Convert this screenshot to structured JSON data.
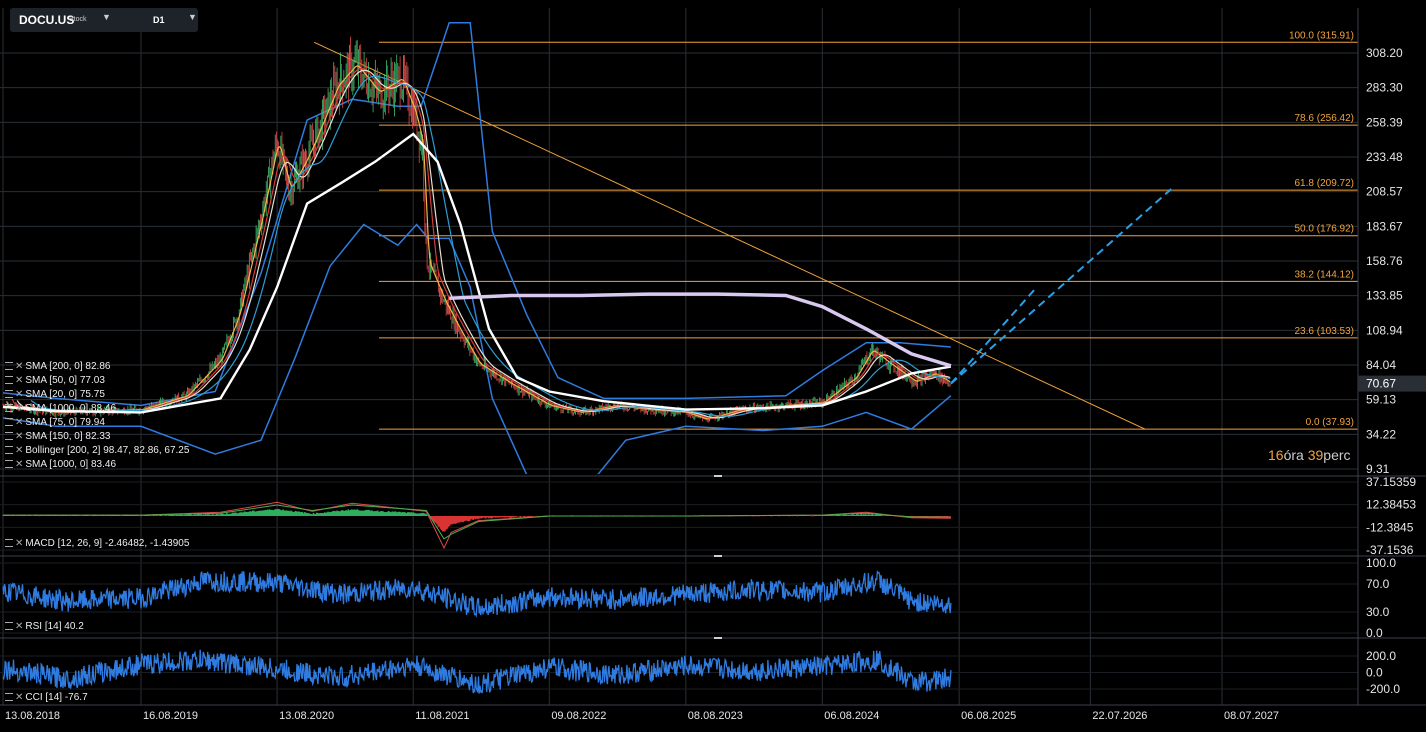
{
  "header": {
    "symbol": "DOCU.US",
    "instrument_type": "Stock",
    "timeframe": "D1",
    "dropdown_glyph": "▼"
  },
  "countdown": {
    "hours": "16",
    "hours_unit": "óra",
    "minutes": "39",
    "minutes_unit": "perc"
  },
  "colors": {
    "background": "#000000",
    "grid": "#2a2f36",
    "fib": "#f2a33c",
    "bollinger": "#2f7be0",
    "sma200": "#ffffff",
    "sma1000": "#d9c8f0",
    "oscillator": "#2f7be0",
    "price_tag": "#2a2f36",
    "projection": "#29a0e8"
  },
  "legends": {
    "main": [
      "SMA [200, 0] 82.86",
      "SMA [50, 0] 77.03",
      "SMA [20, 0] 75.75",
      "SMA [1000, 0] 83.46",
      "SMA [75, 0] 79.94",
      "SMA [150, 0] 82.33",
      "Bollinger [200, 2] 98.47, 82.86, 67.25",
      "SMA [1000, 0] 83.46"
    ],
    "macd": "MACD [12, 26, 9] -2.46482, -1.43905",
    "rsi": "RSI [14] 40.2",
    "cci": "CCI [14] -76.7"
  },
  "chart_data": [
    {
      "type": "line",
      "subtype": "candlestick-with-indicators",
      "x_ticks": [
        "13.08.2018",
        "16.08.2019",
        "13.08.2020",
        "11.08.2021",
        "09.08.2022",
        "08.08.2023",
        "06.08.2024",
        "06.08.2025",
        "22.07.2026",
        "08.07.2027"
      ],
      "y_ticks": [
        308.2,
        283.3,
        258.39,
        233.48,
        208.57,
        183.67,
        158.76,
        133.85,
        108.94,
        84.04,
        59.13,
        34.22,
        9.31
      ],
      "ylim": [
        9.31,
        308.2
      ],
      "last_price": 70.67,
      "price_path": {
        "x": [
          "2018-08-13",
          "2019-01-01",
          "2019-08-16",
          "2019-12-15",
          "2020-03-15",
          "2020-05-01",
          "2020-07-01",
          "2020-08-13",
          "2020-09-15",
          "2020-10-25",
          "2020-11-20",
          "2021-01-20",
          "2021-03-10",
          "2021-05-10",
          "2021-07-10",
          "2021-08-15",
          "2021-09-05",
          "2021-09-15",
          "2021-11-01",
          "2021-12-10",
          "2022-02-01",
          "2022-05-01",
          "2022-08-09",
          "2022-11-01",
          "2023-02-01",
          "2023-05-01",
          "2023-08-08",
          "2023-10-01",
          "2024-01-01",
          "2024-05-01",
          "2024-08-06",
          "2024-11-01",
          "2024-12-15",
          "2025-02-01",
          "2025-04-10",
          "2025-06-01",
          "2025-07-15"
        ],
        "close": [
          55,
          50,
          52,
          62,
          88,
          120,
          190,
          245,
          210,
          230,
          245,
          285,
          300,
          280,
          290,
          265,
          240,
          160,
          130,
          110,
          85,
          70,
          55,
          50,
          55,
          52,
          50,
          45,
          52,
          55,
          57,
          75,
          95,
          85,
          72,
          78,
          70.67
        ]
      },
      "indicators": {
        "bollinger_upper": {
          "x": [
            "2018-08-13",
            "2019-01-01",
            "2019-08-16",
            "2020-03-01",
            "2020-07-01",
            "2020-11-01",
            "2021-03-01",
            "2021-07-01",
            "2021-09-01",
            "2021-11-15",
            "2022-01-10",
            "2022-03-10",
            "2022-06-10",
            "2022-09-01",
            "2023-01-01",
            "2023-08-08",
            "2024-05-01",
            "2024-08-06",
            "2024-12-01",
            "2025-03-01",
            "2025-07-15"
          ],
          "values": [
            64,
            60,
            55,
            65,
            150,
            260,
            275,
            270,
            270,
            330,
            330,
            180,
            120,
            75,
            60,
            60,
            62,
            80,
            100,
            100,
            97
          ]
        },
        "bollinger_lower": {
          "x": [
            "2018-08-13",
            "2019-01-01",
            "2019-08-16",
            "2020-03-01",
            "2020-07-01",
            "2020-10-01",
            "2021-01-01",
            "2021-04-01",
            "2021-07-01",
            "2021-08-20",
            "2021-09-20",
            "2021-11-15",
            "2022-01-10",
            "2022-03-10",
            "2022-06-10",
            "2022-10-01",
            "2023-03-01",
            "2023-08-08",
            "2024-03-01",
            "2024-08-06",
            "2024-12-01",
            "2025-04-01",
            "2025-07-15"
          ],
          "values": [
            46,
            40,
            40,
            20,
            30,
            90,
            155,
            185,
            170,
            185,
            175,
            175,
            140,
            60,
            5,
            -20,
            30,
            40,
            37,
            40,
            50,
            38,
            62
          ]
        },
        "sma_200": {
          "x": [
            "2018-08-13",
            "2019-01-01",
            "2019-08-16",
            "2020-03-15",
            "2020-06-01",
            "2020-08-13",
            "2020-11-01",
            "2021-02-01",
            "2021-05-01",
            "2021-08-11",
            "2021-10-15",
            "2021-12-15",
            "2022-03-01",
            "2022-05-15",
            "2022-08-09",
            "2023-01-01",
            "2023-08-08",
            "2024-03-01",
            "2024-08-06",
            "2024-12-01",
            "2025-04-01",
            "2025-07-15"
          ],
          "values": [
            54,
            51,
            50,
            60,
            95,
            140,
            200,
            215,
            230,
            250,
            230,
            185,
            110,
            75,
            65,
            58,
            52,
            53,
            55,
            65,
            78,
            82.86
          ]
        },
        "sma_1000": {
          "x": [
            "2021-11-15",
            "2022-05-01",
            "2022-11-01",
            "2023-05-01",
            "2023-11-01",
            "2024-05-01",
            "2024-08-06",
            "2024-12-01",
            "2025-04-01",
            "2025-07-15"
          ],
          "values": [
            132,
            134,
            134,
            135,
            135,
            134,
            126,
            110,
            92,
            83.46
          ]
        }
      },
      "fibonacci": [
        {
          "label": "100.0 (315.91)",
          "value": 315.91
        },
        {
          "label": "78.6 (256.42)",
          "value": 256.42
        },
        {
          "label": "61.8 (209.72)",
          "value": 209.72
        },
        {
          "label": "50.0 (176.92)",
          "value": 176.92
        },
        {
          "label": "38.2 (144.12)",
          "value": 144.12
        },
        {
          "label": "23.6 (103.53)",
          "value": 103.53
        },
        {
          "label": "0.0 (37.93)",
          "value": 37.93
        }
      ],
      "trendline": {
        "x": [
          "2020-11-20",
          "2026-12-15"
        ],
        "values": [
          315.91,
          37.93
        ]
      },
      "projections": [
        {
          "x": [
            "2025-07-15",
            "2026-03-01"
          ],
          "values": [
            70.67,
            140
          ]
        },
        {
          "x": [
            "2025-07-15",
            "2027-03-01"
          ],
          "values": [
            70.67,
            212
          ]
        }
      ]
    },
    {
      "type": "line",
      "name": "MACD",
      "y_ticks": [
        37.15359,
        12.38453,
        -12.3845,
        -37.1536
      ],
      "ylim": [
        -37.1536,
        37.15359
      ],
      "x": [
        "2018-08-13",
        "2019-08-16",
        "2020-03-15",
        "2020-08-13",
        "2020-11-15",
        "2021-03-01",
        "2021-09-15",
        "2021-11-01",
        "2021-11-20",
        "2022-02-01",
        "2022-08-09",
        "2023-08-08",
        "2024-08-06",
        "2024-12-01",
        "2025-04-01",
        "2025-07-15"
      ],
      "series": [
        {
          "values": [
            1,
            1,
            4,
            15,
            5,
            14,
            5,
            -35,
            -18,
            -5,
            0,
            0,
            1,
            4,
            -2,
            -2.46
          ]
        },
        {
          "values": [
            1,
            1,
            3,
            12,
            6,
            12,
            6,
            -25,
            -20,
            -6,
            0,
            0,
            1,
            3,
            -1,
            -1.44
          ]
        }
      ]
    },
    {
      "type": "line",
      "name": "RSI",
      "y_ticks": [
        100,
        70,
        30,
        0
      ],
      "ylim": [
        0,
        100
      ],
      "x": [
        "2018-08-13",
        "2019-02-01",
        "2019-08-16",
        "2020-02-01",
        "2020-08-13",
        "2021-02-01",
        "2021-08-11",
        "2022-02-01",
        "2022-08-09",
        "2023-02-01",
        "2023-08-08",
        "2024-02-01",
        "2024-08-06",
        "2025-01-01",
        "2025-04-01",
        "2025-07-15"
      ],
      "values": [
        60,
        45,
        50,
        75,
        72,
        55,
        65,
        35,
        52,
        48,
        55,
        62,
        58,
        75,
        45,
        40.2
      ]
    },
    {
      "type": "line",
      "name": "CCI",
      "y_ticks": [
        200,
        0,
        -200
      ],
      "ylim": [
        -320,
        320
      ],
      "x": [
        "2018-08-13",
        "2019-02-01",
        "2019-08-16",
        "2020-02-01",
        "2020-08-13",
        "2021-02-01",
        "2021-08-11",
        "2022-02-01",
        "2022-08-09",
        "2023-02-01",
        "2023-08-08",
        "2024-02-01",
        "2024-08-06",
        "2025-01-01",
        "2025-04-01",
        "2025-07-15"
      ],
      "values": [
        50,
        -80,
        100,
        150,
        40,
        -60,
        90,
        -150,
        60,
        -30,
        80,
        20,
        70,
        160,
        -120,
        -76.7
      ]
    }
  ]
}
